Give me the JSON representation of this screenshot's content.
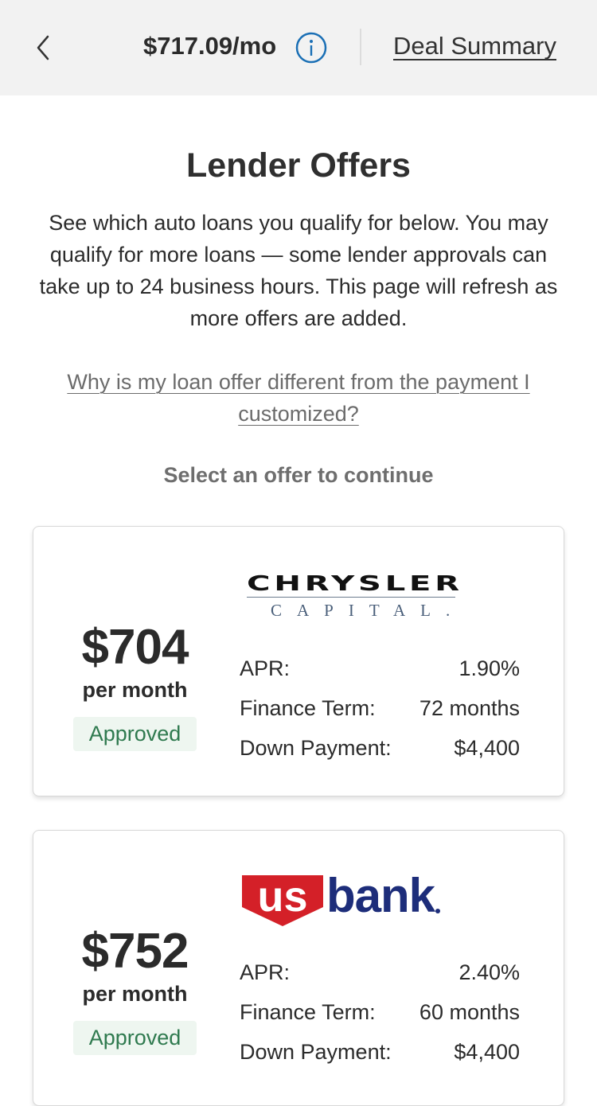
{
  "header": {
    "monthly_payment": "$717.09/mo",
    "deal_summary_label": "Deal Summary"
  },
  "page": {
    "title": "Lender Offers",
    "intro": "See which auto loans you qualify for below. You may qualify for more loans — some lender approvals can take up to 24 business hours. This page will refresh as more offers are added.",
    "why_link": "Why is my loan offer different from the payment I customized?",
    "select_prompt": "Select an offer to continue"
  },
  "offers": [
    {
      "lender": "Chrysler Capital",
      "logo_text_top": "CHRYSLER",
      "logo_text_bottom": "CAPITAL.",
      "amount": "$704",
      "per_month": "per month",
      "status": "Approved",
      "apr_label": "APR:",
      "apr": "1.90%",
      "term_label": "Finance Term:",
      "term": "72 months",
      "down_label": "Down Payment:",
      "down": "$4,400"
    },
    {
      "lender": "US Bank",
      "logo_text_us": "us",
      "logo_text_bank": "bank",
      "amount": "$752",
      "per_month": "per month",
      "status": "Approved",
      "apr_label": "APR:",
      "apr": "2.40%",
      "term_label": "Finance Term:",
      "term": "60 months",
      "down_label": "Down Payment:",
      "down": "$4,400"
    }
  ],
  "colors": {
    "header_bg": "#f2f2f2",
    "approved_text": "#2f7a4f",
    "approved_bg": "#eef6f0",
    "info_icon": "#1a6fb5",
    "usbank_red": "#d42028",
    "usbank_blue": "#1d2d7a"
  },
  "icons": {
    "back": "chevron-left-icon",
    "info": "info-circle-icon"
  }
}
